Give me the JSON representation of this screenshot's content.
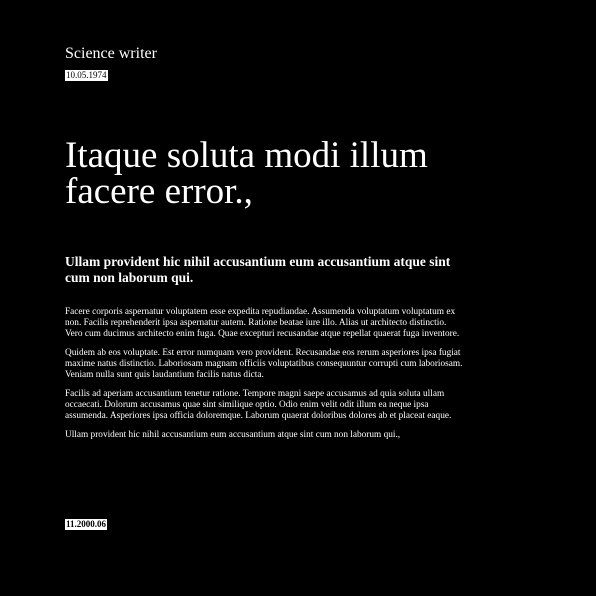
{
  "header": {
    "author": "Science writer",
    "date": "10.05.1974"
  },
  "article": {
    "title": "Itaque soluta modi illum facere error.,",
    "subtitle": "Ullam provident hic nihil accusantium eum accusantium atque sint cum non laborum qui.",
    "paragraphs": [
      "Facere corporis aspernatur voluptatem esse expedita repudiandae. Assumenda voluptatum voluptatum ex non. Facilis reprehenderit ipsa aspernatur autem. Ratione beatae iure illo. Alias ut architecto distinctio. Vero cum ducimus architecto enim fuga. Quae excepturi recusandae atque repellat quaerat fuga inventore.",
      "Quidem ab eos voluptate. Est error numquam vero provident. Recusandae eos rerum asperiores ipsa fugiat maxime natus distinctio. Laboriosam magnam officiis voluptatibus consequuntur corrupti cum laboriosam. Veniam nulla sunt quis laudantium facilis natus dicta.",
      "Facilis ad aperiam accusantium tenetur ratione. Tempore magni saepe accusamus ad quia soluta ullam occaecati. Dolorum accusamus quae sint similique optio. Odio enim velit odit illum ea neque ipsa assumenda. Asperiores ipsa officia doloremque. Laborum quaerat doloribus dolores ab et placeat eaque.",
      "Ullam provident hic nihil accusantium eum accusantium atque sint cum non laborum qui.,"
    ]
  },
  "footer": {
    "date": "11.2000.06"
  },
  "colors": {
    "background": "#000000",
    "text": "#ffffff"
  }
}
